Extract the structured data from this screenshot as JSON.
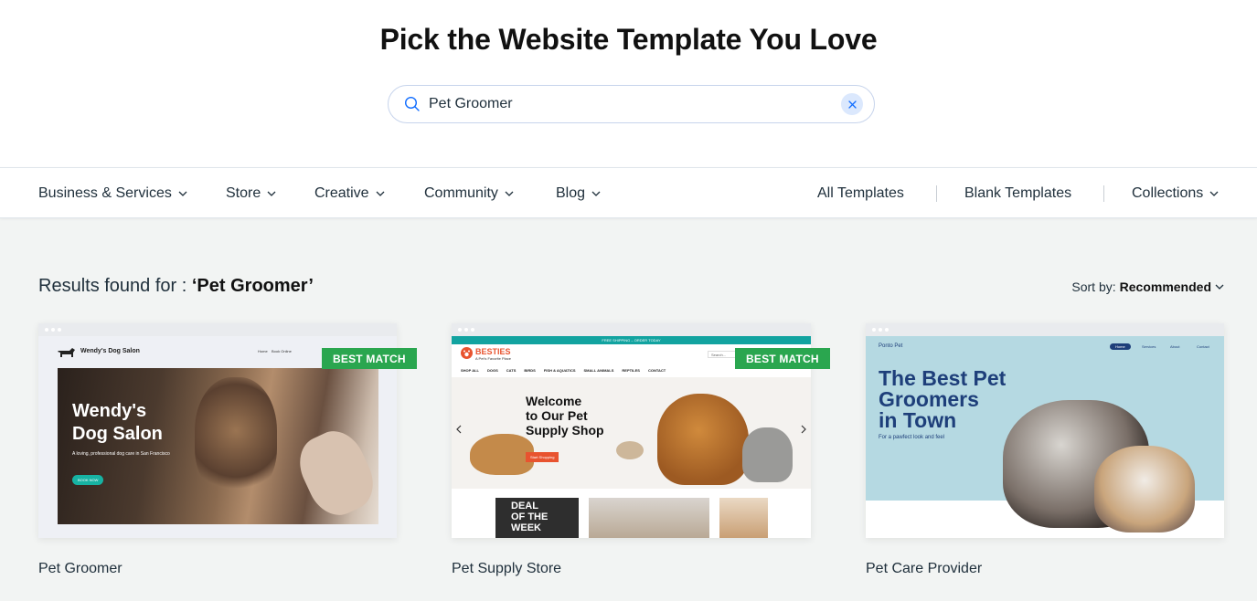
{
  "page": {
    "title": "Pick the Website Template You Love"
  },
  "search": {
    "value": "Pet Groomer"
  },
  "nav": {
    "categories": [
      "Business & Services",
      "Store",
      "Creative",
      "Community",
      "Blog"
    ],
    "links": [
      "All Templates",
      "Blank Templates",
      "Collections"
    ]
  },
  "results": {
    "prefix": "Results found for :",
    "query": "‘Pet Groomer’"
  },
  "sort": {
    "label": "Sort by:",
    "value": "Recommended"
  },
  "badge_label": "BEST MATCH",
  "templates": [
    {
      "name": "Pet Groomer",
      "preview": {
        "brand": "Wendy's Dog Salon",
        "nav": [
          "Home",
          "Book Online"
        ],
        "headline": [
          "Wendy's",
          "Dog Salon"
        ],
        "tagline": "A loving, professional dog care in San Francisco",
        "cta": "BOOK NOW"
      }
    },
    {
      "name": "Pet Supply Store",
      "preview": {
        "banner": "FREE SHIPPING – ORDER TODAY",
        "brand": "BESTIES",
        "brand_sub": "A Pet's Favorite Place",
        "search": "Search...",
        "menu": [
          "SHOP ALL",
          "DOGS",
          "CATS",
          "BIRDS",
          "FISH & AQUATICS",
          "SMALL ANIMALS",
          "REPTILES",
          "CONTACT"
        ],
        "headline": [
          "Welcome",
          "to Our Pet",
          "Supply Shop"
        ],
        "cta": "Start Shopping",
        "deal": [
          "DEAL",
          "OF THE",
          "WEEK"
        ]
      }
    },
    {
      "name": "Pet Care Provider",
      "preview": {
        "brand": "Ponto Pet",
        "nav": [
          "Home",
          "Services",
          "About",
          "Contact"
        ],
        "headline": [
          "The Best Pet",
          "Groomers",
          "in Town"
        ],
        "tagline": "For a pawfect look and feel"
      }
    }
  ],
  "colors": {
    "accent": "#116dff",
    "badge": "#2aa64f",
    "card3_bg": "#b5d9e2",
    "card3_text": "#1e3f7a",
    "besties": "#e8532f",
    "teal_banner": "#12a3a0"
  }
}
